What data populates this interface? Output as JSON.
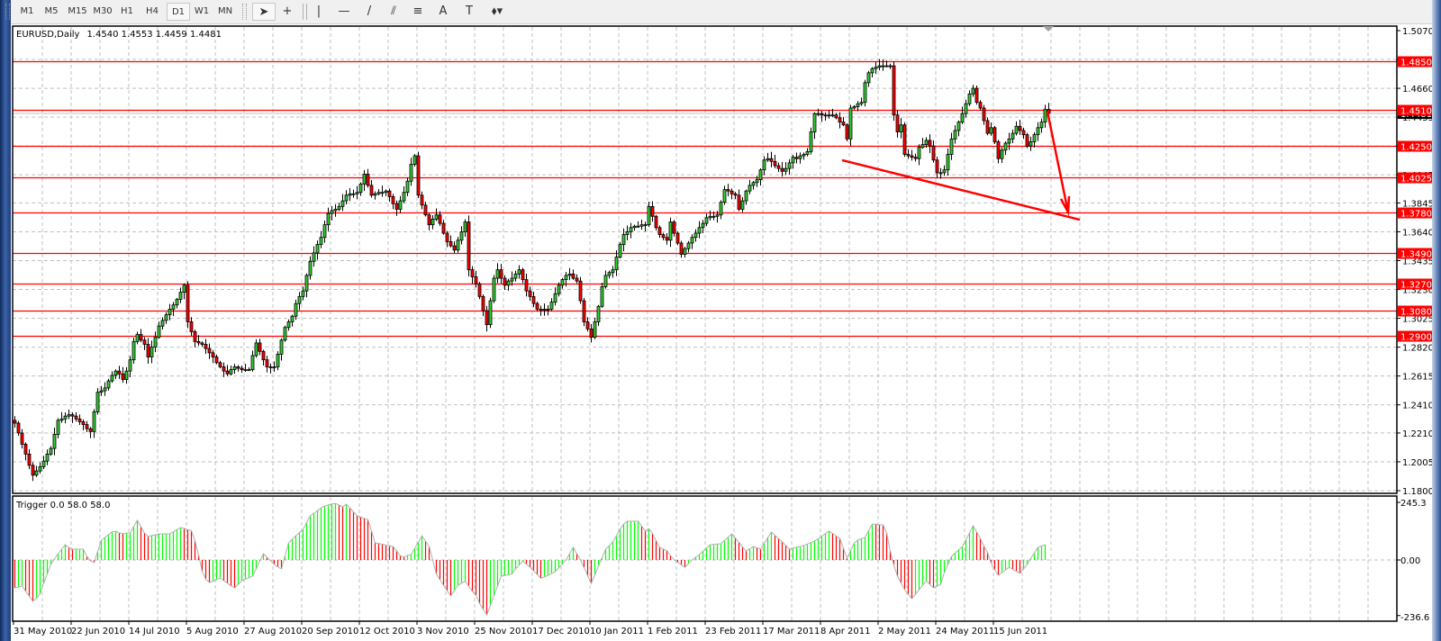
{
  "toolbar": {
    "timeframes": [
      "M1",
      "M5",
      "M15",
      "M30",
      "H1",
      "H4",
      "D1",
      "W1",
      "MN"
    ],
    "active_timeframe": "D1",
    "tools": [
      {
        "name": "cursor-icon",
        "glyph": "➤"
      },
      {
        "name": "crosshair-icon",
        "glyph": "+"
      },
      {
        "name": "vertical-line-icon",
        "glyph": "|"
      },
      {
        "name": "horizontal-line-icon",
        "glyph": "—"
      },
      {
        "name": "trendline-icon",
        "glyph": "/"
      },
      {
        "name": "equidistant-channel-icon",
        "glyph": "⫽"
      },
      {
        "name": "fibonacci-icon",
        "glyph": "≡"
      },
      {
        "name": "text-icon",
        "glyph": "A"
      },
      {
        "name": "text-label-icon",
        "glyph": "T"
      },
      {
        "name": "arrows-icon",
        "glyph": "⬧▾"
      }
    ]
  },
  "chart": {
    "symbol": "EURUSD,Daily",
    "ohlc": "1.4540 1.4553 1.4459 1.4481",
    "indicator_label": "Trigger 0.0 58.0 58.0",
    "current_price": "1.4481"
  },
  "colors": {
    "bull": "#32cd32",
    "bear": "#ff0000",
    "level_line": "#ff0000",
    "grid": "#c0c0c0",
    "indicator_up": "#00ff00",
    "indicator_down": "#ff0000"
  },
  "chart_data": [
    {
      "type": "candlestick",
      "title": "EURUSD,Daily",
      "ylim": [
        1.18,
        1.507
      ],
      "grid": true,
      "y_ticks": [
        "1.5070",
        "1.4865",
        "1.4660",
        "1.4455",
        "1.4250",
        "1.4045",
        "1.3845",
        "1.3640",
        "1.3435",
        "1.3230",
        "1.3025",
        "1.2820",
        "1.2615",
        "1.2410",
        "1.2210",
        "1.2005",
        "1.1800"
      ],
      "x_tick_labels": [
        "31 May 2010",
        "22 Jun 2010",
        "14 Jul 2010",
        "5 Aug 2010",
        "27 Aug 2010",
        "20 Sep 2010",
        "12 Oct 2010",
        "3 Nov 2010",
        "25 Nov 2010",
        "17 Dec 2010",
        "10 Jan 2011",
        "1 Feb 2011",
        "23 Feb 2011",
        "17 Mar 2011",
        "8 Apr 2011",
        "2 May 2011",
        "24 May 2011",
        "15 Jun 2011"
      ],
      "first_open": 1.23,
      "closes": [
        1.228,
        1.221,
        1.213,
        1.206,
        1.198,
        1.191,
        1.194,
        1.197,
        1.201,
        1.206,
        1.21,
        1.22,
        1.23,
        1.231,
        1.233,
        1.234,
        1.233,
        1.231,
        1.229,
        1.227,
        1.224,
        1.222,
        1.236,
        1.25,
        1.251,
        1.253,
        1.258,
        1.262,
        1.265,
        1.263,
        1.259,
        1.265,
        1.273,
        1.286,
        1.291,
        1.287,
        1.284,
        1.275,
        1.282,
        1.289,
        1.297,
        1.301,
        1.305,
        1.309,
        1.312,
        1.316,
        1.321,
        1.326,
        1.3,
        1.293,
        1.286,
        1.285,
        1.284,
        1.281,
        1.278,
        1.275,
        1.271,
        1.268,
        1.265,
        1.263,
        1.266,
        1.268,
        1.267,
        1.266,
        1.266,
        1.266,
        1.276,
        1.285,
        1.279,
        1.273,
        1.268,
        1.268,
        1.268,
        1.277,
        1.287,
        1.296,
        1.3,
        1.304,
        1.313,
        1.318,
        1.322,
        1.333,
        1.343,
        1.349,
        1.355,
        1.36,
        1.369,
        1.377,
        1.379,
        1.38,
        1.382,
        1.386,
        1.39,
        1.391,
        1.391,
        1.392,
        1.398,
        1.405,
        1.397,
        1.39,
        1.391,
        1.392,
        1.392,
        1.393,
        1.389,
        1.384,
        1.38,
        1.386,
        1.392,
        1.4,
        1.412,
        1.418,
        1.39,
        1.383,
        1.376,
        1.369,
        1.373,
        1.376,
        1.37,
        1.363,
        1.357,
        1.354,
        1.351,
        1.358,
        1.364,
        1.371,
        1.337,
        1.332,
        1.327,
        1.318,
        1.308,
        1.298,
        1.315,
        1.331,
        1.337,
        1.331,
        1.326,
        1.329,
        1.331,
        1.334,
        1.337,
        1.33,
        1.322,
        1.318,
        1.313,
        1.309,
        1.309,
        1.309,
        1.309,
        1.314,
        1.32,
        1.326,
        1.33,
        1.333,
        1.334,
        1.331,
        1.329,
        1.315,
        1.3,
        1.295,
        1.289,
        1.3,
        1.311,
        1.325,
        1.333,
        1.335,
        1.337,
        1.346,
        1.355,
        1.362,
        1.364,
        1.367,
        1.368,
        1.368,
        1.369,
        1.369,
        1.382,
        1.375,
        1.367,
        1.362,
        1.36,
        1.358,
        1.371,
        1.363,
        1.356,
        1.348,
        1.352,
        1.356,
        1.36,
        1.363,
        1.367,
        1.37,
        1.374,
        1.375,
        1.375,
        1.376,
        1.385,
        1.394,
        1.393,
        1.391,
        1.39,
        1.38,
        1.386,
        1.393,
        1.397,
        1.399,
        1.401,
        1.408,
        1.415,
        1.416,
        1.414,
        1.411,
        1.409,
        1.407,
        1.409,
        1.413,
        1.417,
        1.416,
        1.418,
        1.419,
        1.421,
        1.435,
        1.448,
        1.448,
        1.447,
        1.447,
        1.447,
        1.447,
        1.445,
        1.442,
        1.44,
        1.43,
        1.452,
        1.453,
        1.455,
        1.456,
        1.47,
        1.477,
        1.48,
        1.481,
        1.482,
        1.482,
        1.482,
        1.482,
        1.447,
        1.435,
        1.44,
        1.419,
        1.418,
        1.417,
        1.416,
        1.424,
        1.426,
        1.429,
        1.425,
        1.415,
        1.406,
        1.406,
        1.408,
        1.419,
        1.43,
        1.436,
        1.442,
        1.448,
        1.455,
        1.462,
        1.466,
        1.456,
        1.452,
        1.443,
        1.434,
        1.438,
        1.428,
        1.416,
        1.422,
        1.427,
        1.43,
        1.434,
        1.439,
        1.436,
        1.433,
        1.425,
        1.428,
        1.433,
        1.438,
        1.442,
        1.451,
        1.4481
      ],
      "levels": [
        "1.4850",
        "1.4510",
        "1.4250",
        "1.4025",
        "1.3780",
        "1.3490",
        "1.3270",
        "1.3080",
        "1.2900"
      ],
      "trendline_prices": [
        1.4149,
        1.3726
      ],
      "arrow_prices": [
        1.4494,
        1.3778
      ]
    },
    {
      "type": "bar",
      "title": "Trigger 0.0 58.0 58.0",
      "ylim": [
        -236.6,
        245.3
      ],
      "y_ticks": [
        "245.3",
        "0.00",
        "-236.6"
      ],
      "values": [
        -119,
        -115,
        -111,
        -133,
        -154,
        -176,
        -163,
        -144,
        -99,
        -60,
        -19,
        4,
        27,
        46,
        65,
        52,
        46,
        46,
        46,
        46,
        15,
        -4,
        -11,
        37,
        84,
        96,
        108,
        120,
        122,
        115,
        112,
        114,
        115,
        142,
        169,
        142,
        114,
        100,
        104,
        107,
        111,
        111,
        111,
        111,
        120,
        129,
        138,
        134,
        129,
        125,
        82,
        21,
        -50,
        -82,
        -96,
        -90,
        -83,
        -77,
        -88,
        -99,
        -110,
        -119,
        -104,
        -88,
        -82,
        -75,
        -69,
        -37,
        -5,
        27,
        11,
        -3,
        -19,
        -29,
        -38,
        18,
        73,
        88,
        103,
        117,
        130,
        159,
        188,
        199,
        210,
        221,
        230,
        234,
        238,
        241,
        234,
        226,
        238,
        221,
        205,
        188,
        183,
        177,
        172,
        123,
        73,
        70,
        67,
        63,
        60,
        57,
        38,
        18,
        13,
        19,
        23,
        50,
        76,
        103,
        80,
        57,
        0,
        -60,
        -84,
        -108,
        -131,
        -153,
        -130,
        -107,
        -99,
        -91,
        -111,
        -134,
        -150,
        -185,
        -210,
        -234,
        -193,
        -152,
        -110,
        -69,
        -66,
        -62,
        -59,
        -38,
        -21,
        -4,
        -18,
        -31,
        -46,
        -62,
        -78,
        -72,
        -65,
        -58,
        -50,
        -33,
        -17,
        0,
        27,
        54,
        27,
        0,
        -33,
        -67,
        -100,
        -63,
        -26,
        10,
        46,
        61,
        77,
        104,
        131,
        153,
        165,
        165,
        165,
        165,
        144,
        123,
        133,
        113,
        82,
        54,
        46,
        40,
        19,
        0,
        -10,
        -21,
        -31,
        -15,
        0,
        12,
        23,
        37,
        51,
        65,
        66,
        68,
        69,
        83,
        97,
        111,
        93,
        75,
        56,
        38,
        48,
        57,
        52,
        46,
        70,
        95,
        119,
        105,
        91,
        77,
        62,
        46,
        50,
        54,
        57,
        61,
        68,
        75,
        81,
        90,
        101,
        112,
        123,
        113,
        102,
        92,
        50,
        8,
        40,
        72,
        85,
        91,
        96,
        125,
        153,
        152,
        150,
        149,
        115,
        38,
        -23,
        -69,
        -98,
        -126,
        -146,
        -165,
        -146,
        -126,
        -107,
        -88,
        -104,
        -119,
        -111,
        -104,
        -54,
        -19,
        15,
        29,
        43,
        57,
        86,
        115,
        146,
        119,
        92,
        59,
        32,
        -14,
        -42,
        -65,
        -54,
        -42,
        -31,
        -40,
        -48,
        -57,
        -38,
        -19,
        6,
        30,
        54,
        60,
        65
      ]
    }
  ]
}
